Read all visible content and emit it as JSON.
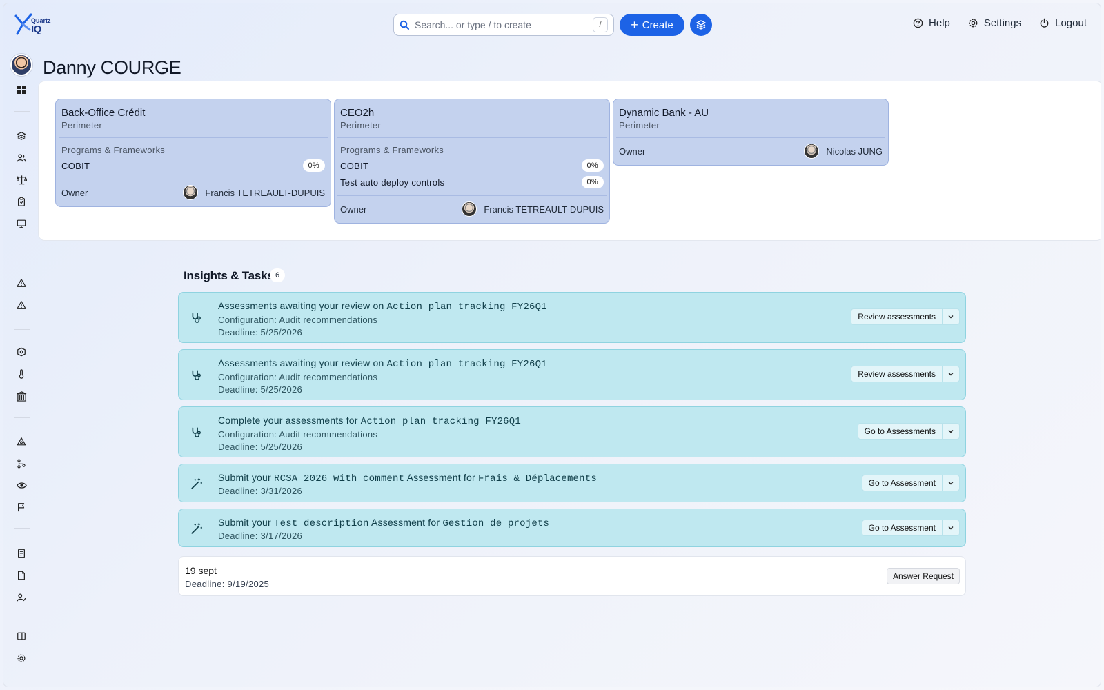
{
  "app": {
    "logo_small": "Quartz",
    "logo_big": "IQ"
  },
  "search": {
    "placeholder": "Search... or type / to create",
    "shortcut": "/"
  },
  "header": {
    "create_label": "Create",
    "help_label": "Help",
    "settings_label": "Settings",
    "logout_label": "Logout"
  },
  "colors": {
    "accent": "#1d63e6",
    "perimeter_card": "#c4d2ee",
    "task_card": "#bfe8f0"
  },
  "user": {
    "name": "Danny COURGE"
  },
  "perimeters": [
    {
      "name": "Back-Office Crédit",
      "type": "Perimeter",
      "programs_label": "Programs & Frameworks",
      "programs": [
        {
          "name": "COBIT",
          "progress": "0%"
        }
      ],
      "owner_label": "Owner",
      "owner": "Francis TETREAULT-DUPUIS"
    },
    {
      "name": "CEO2h",
      "type": "Perimeter",
      "programs_label": "Programs & Frameworks",
      "programs": [
        {
          "name": "COBIT",
          "progress": "0%"
        },
        {
          "name": "Test auto deploy controls",
          "progress": "0%"
        }
      ],
      "owner_label": "Owner",
      "owner": "Francis TETREAULT-DUPUIS"
    },
    {
      "name": "Dynamic Bank - AU",
      "type": "Perimeter",
      "owner_label": "Owner",
      "owner": "Nicolas JUNG"
    }
  ],
  "insights": {
    "title": "Insights & Tasks",
    "count": "6",
    "tasks": [
      {
        "icon": "stethoscope-icon",
        "text": "Assessments awaiting your review on",
        "code": "Action plan tracking FY26Q1",
        "config": "Configuration: Audit recommendations",
        "deadline": "Deadline: 5/25/2026",
        "action": "Review assessments"
      },
      {
        "icon": "stethoscope-icon",
        "text": "Assessments awaiting your review on",
        "code": "Action plan tracking FY26Q1",
        "config": "Configuration: Audit recommendations",
        "deadline": "Deadline: 5/25/2026",
        "action": "Review assessments"
      },
      {
        "icon": "stethoscope-icon",
        "text": "Complete your assessments for",
        "code": "Action plan tracking FY26Q1",
        "config": "Configuration: Audit recommendations",
        "deadline": "Deadline: 5/25/2026",
        "action": "Go to Assessments"
      },
      {
        "icon": "magic-wand-icon",
        "text_a": "Submit your",
        "code_a": "RCSA 2026 with comment",
        "text_b": "Assessment for",
        "code_b": "Frais & Déplacements",
        "deadline": "Deadline: 3/31/2026",
        "action": "Go to Assessment"
      },
      {
        "icon": "magic-wand-icon",
        "text_a": "Submit your",
        "code_a": "Test description",
        "text_b": "Assessment for",
        "code_b": "Gestion de projets",
        "deadline": "Deadline: 3/17/2026",
        "action": "Go to Assessment"
      }
    ],
    "request": {
      "title": "19 sept",
      "deadline": "Deadline: 9/19/2025",
      "action": "Answer Request"
    }
  }
}
